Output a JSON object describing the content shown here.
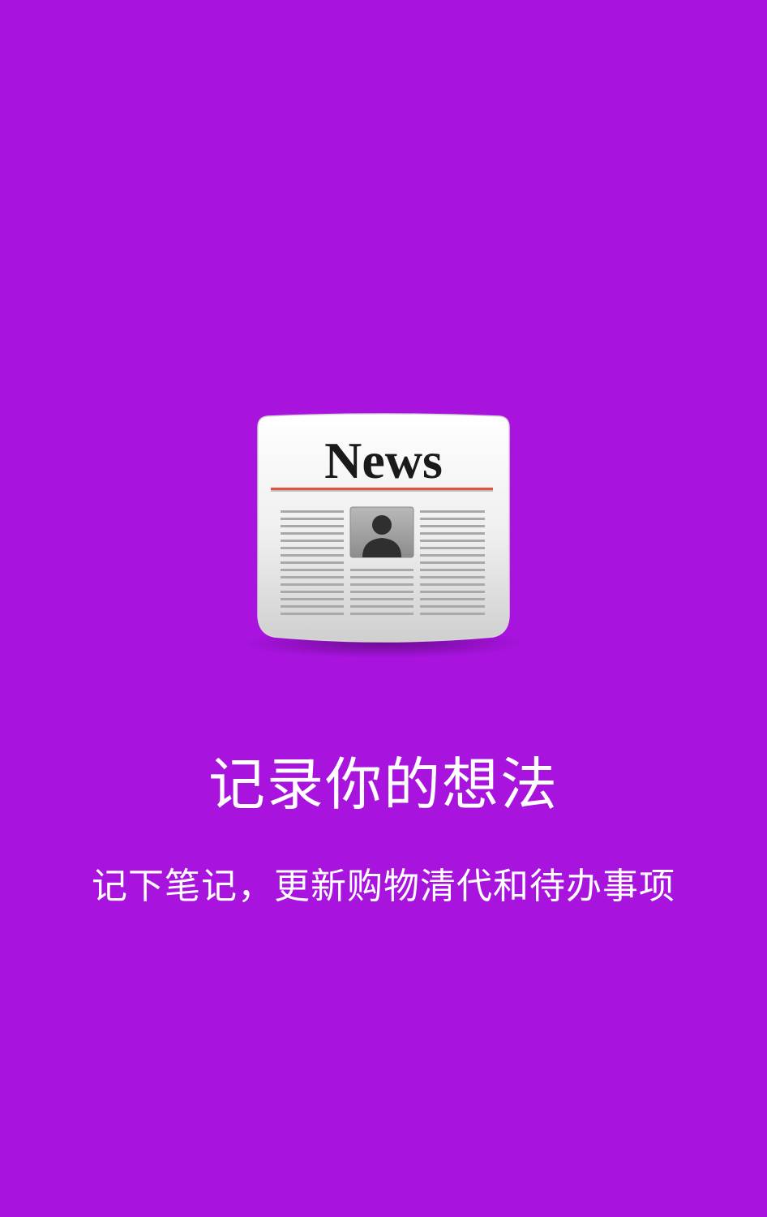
{
  "theme": {
    "background": "#a813de",
    "text_color": "#ffffff"
  },
  "logo": {
    "icon": "newspaper-icon",
    "masthead": "News"
  },
  "onboarding": {
    "title": "记录你的想法",
    "subtitle": "记下笔记，更新购物清代和待办事项"
  }
}
